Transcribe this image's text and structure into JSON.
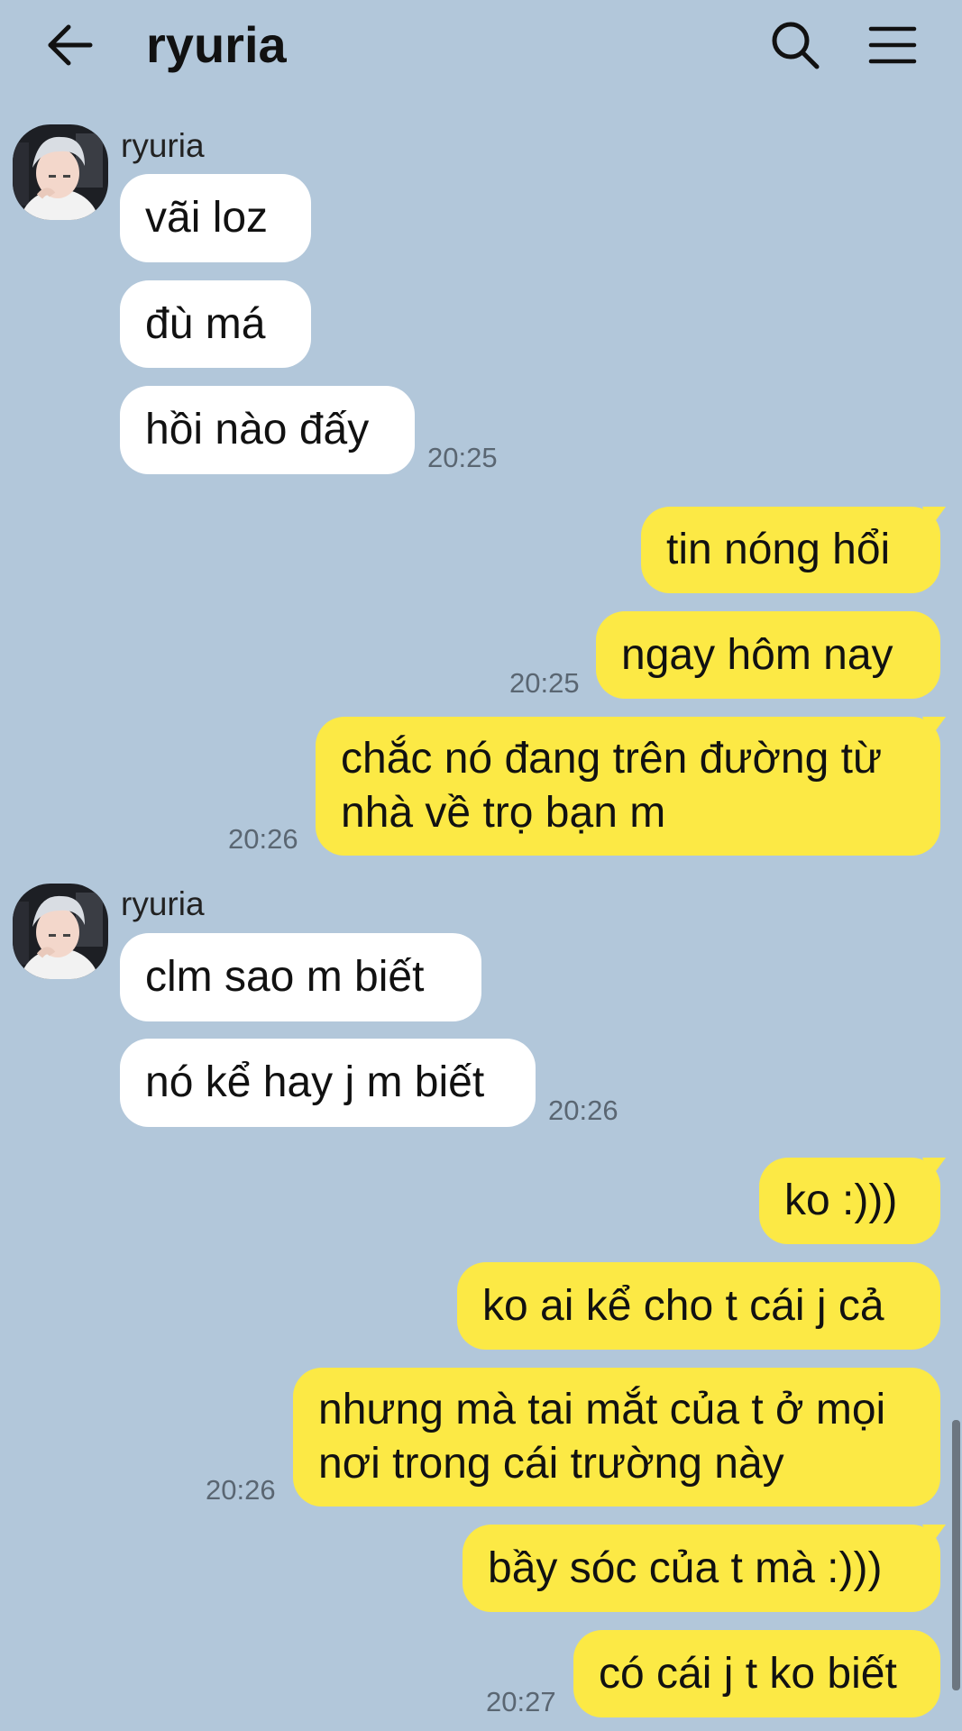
{
  "header": {
    "title": "ryuria",
    "back_icon": "arrow-left-icon",
    "search_icon": "search-icon",
    "menu_icon": "hamburger-menu-icon"
  },
  "colors": {
    "background": "#b2c7da",
    "incoming_bubble": "#ffffff",
    "outgoing_bubble": "#fce945"
  },
  "groups": [
    {
      "sender": "ryuria",
      "messages": [
        "vãi loz",
        "đù má",
        "hồi nào đấy"
      ],
      "time": "20:25"
    },
    {
      "messages": [
        "tin nóng hổi",
        "ngay hôm nay"
      ],
      "time": "20:25"
    },
    {
      "messages": [
        "chắc nó đang trên đường từ nhà về trọ bạn m"
      ],
      "time": "20:26"
    },
    {
      "sender": "ryuria",
      "messages": [
        "clm sao m biết",
        "nó kể hay j m biết"
      ],
      "time": "20:26"
    },
    {
      "messages": [
        "ko :)))",
        "ko ai kể cho t cái j cả",
        "nhưng mà tai mắt của t ở mọi nơi trong cái trường này"
      ],
      "time": "20:26"
    },
    {
      "messages": [
        "bầy sóc của t mà :)))",
        "có cái j t ko biết"
      ],
      "time": "20:27"
    }
  ]
}
